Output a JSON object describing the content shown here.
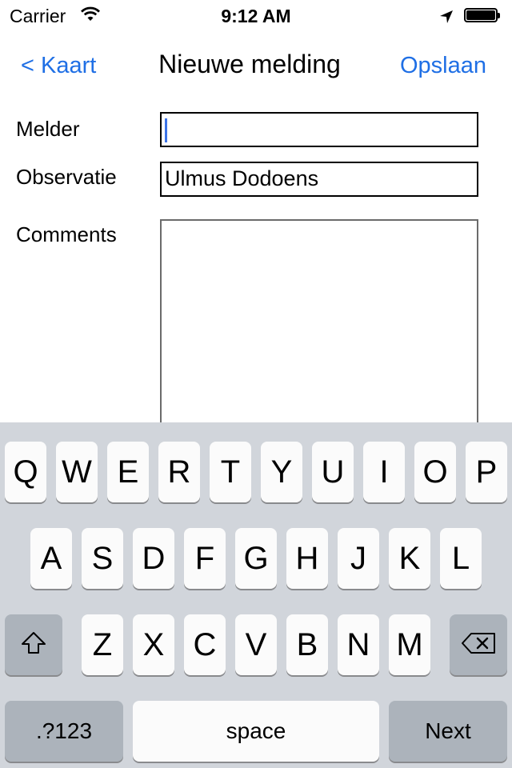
{
  "status_bar": {
    "carrier": "Carrier",
    "time": "9:12 AM",
    "icons": [
      "wifi-icon",
      "location-arrow-icon",
      "battery-icon"
    ]
  },
  "nav": {
    "back_label": "< Kaart",
    "title": "Nieuwe melding",
    "save_label": "Opslaan",
    "accent_color": "#1f6fe5"
  },
  "form": {
    "melder_label": "Melder",
    "melder_value": "",
    "observatie_label": "Observatie",
    "observatie_value": "Ulmus Dodoens",
    "comments_label": "Comments",
    "comments_value": ""
  },
  "keyboard": {
    "row1": [
      "Q",
      "W",
      "E",
      "R",
      "T",
      "Y",
      "U",
      "I",
      "O",
      "P"
    ],
    "row2": [
      "A",
      "S",
      "D",
      "F",
      "G",
      "H",
      "J",
      "K",
      "L"
    ],
    "row3": [
      "Z",
      "X",
      "C",
      "V",
      "B",
      "N",
      "M"
    ],
    "numbers_label": ".?123",
    "space_label": "space",
    "next_label": "Next",
    "shift_icon": "shift-arrow-icon",
    "delete_icon": "backspace-icon"
  }
}
